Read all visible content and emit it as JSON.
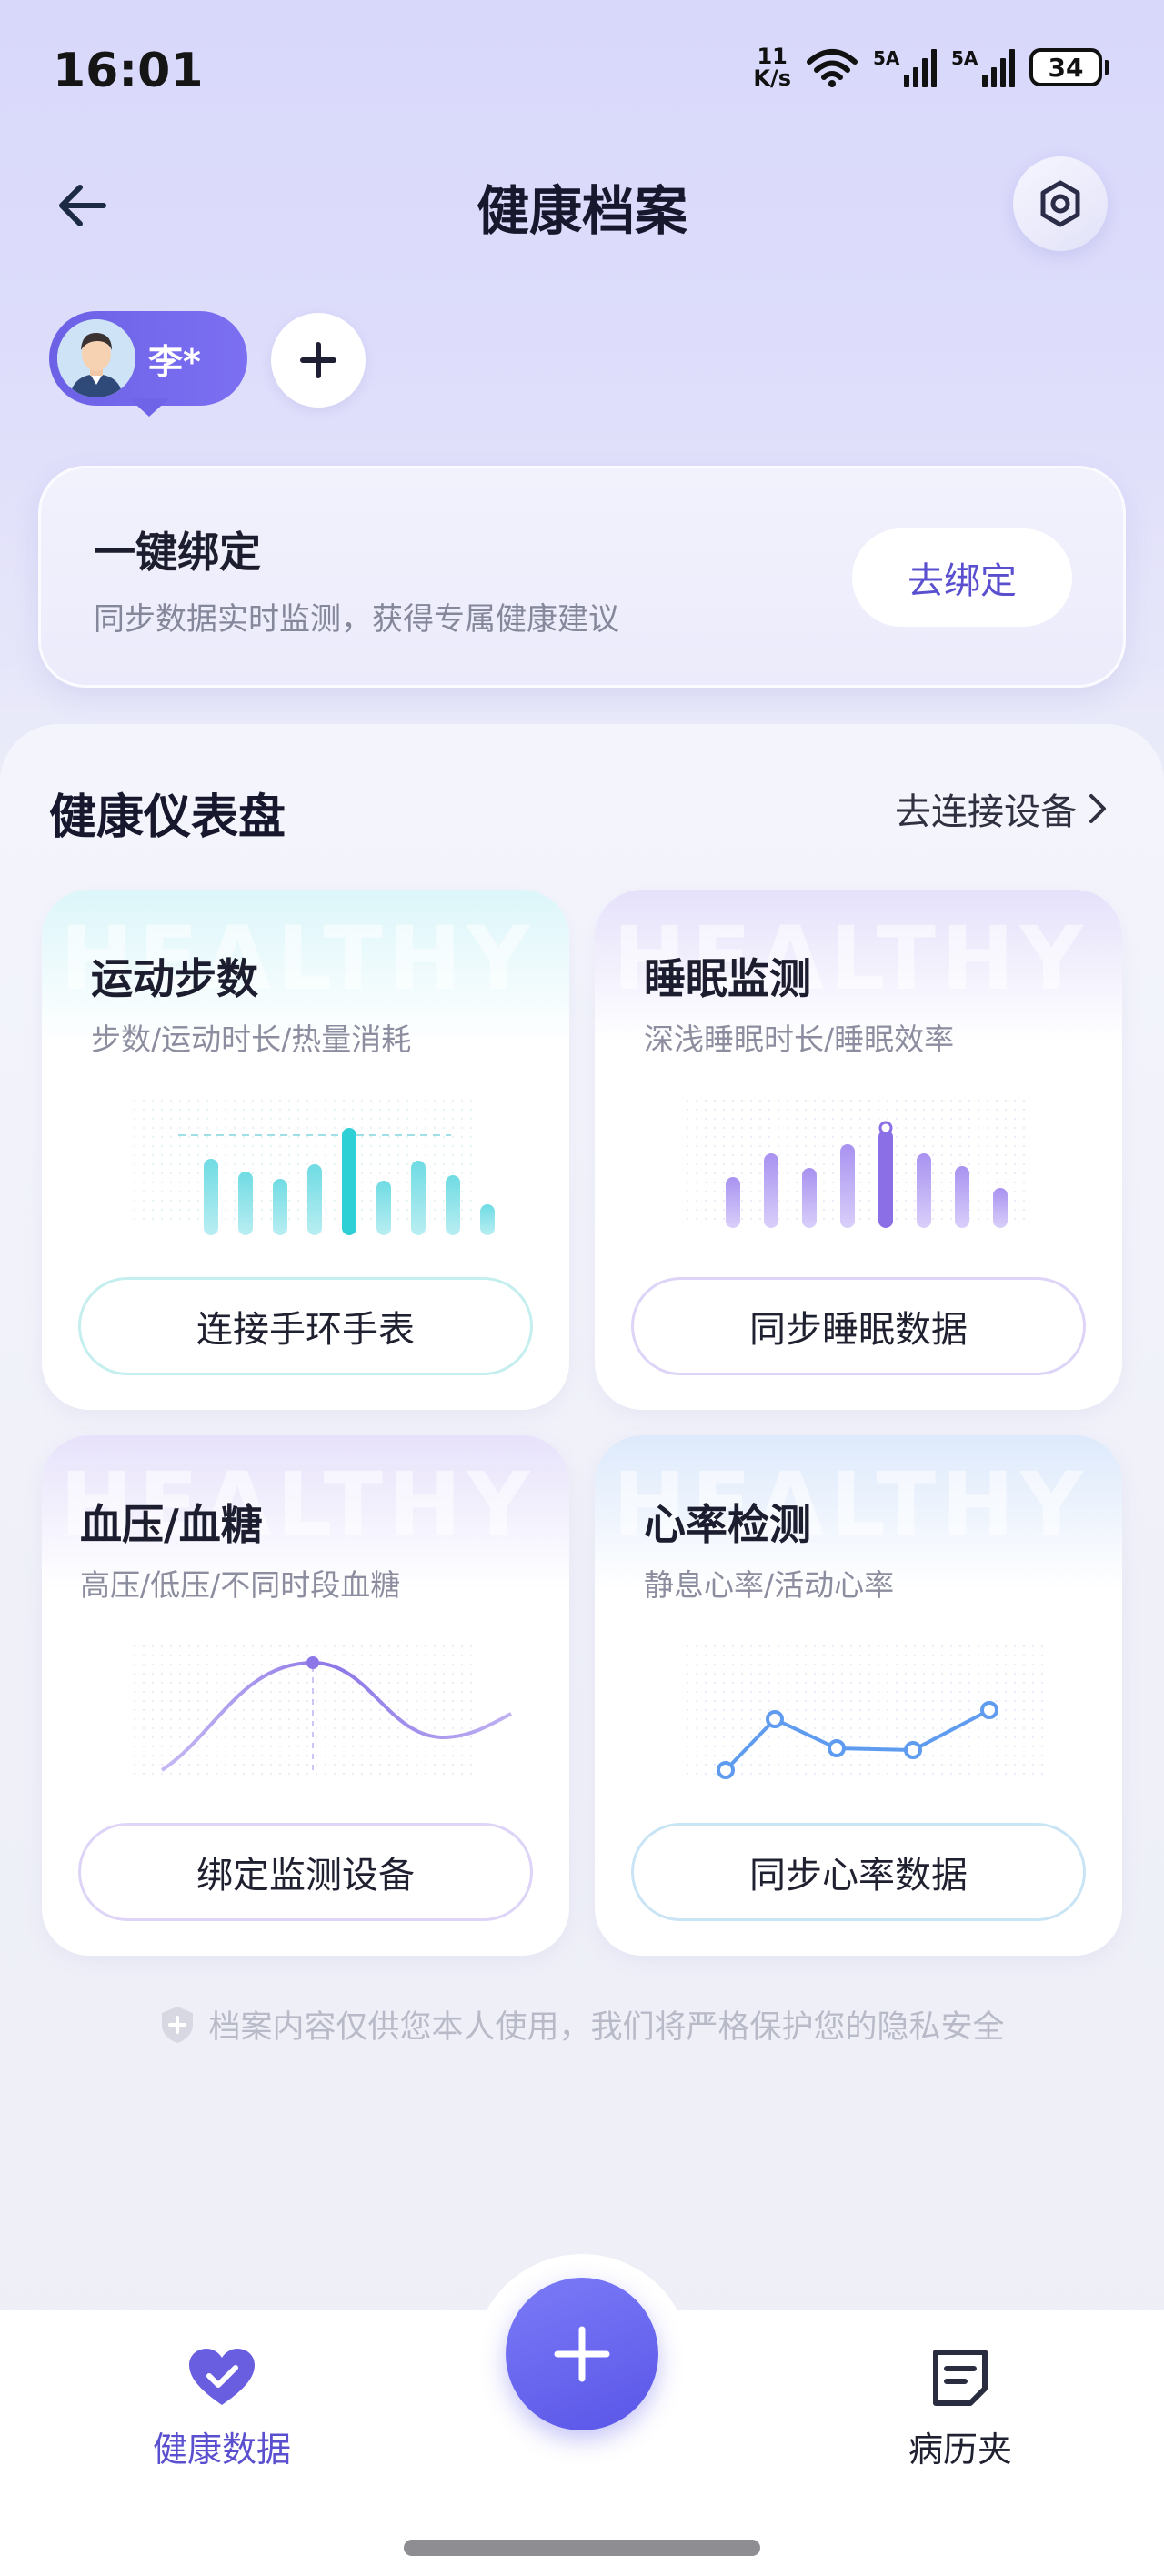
{
  "status_bar": {
    "time": "16:01",
    "net_speed_value": "11",
    "net_speed_unit": "K/s",
    "sim1": "5A",
    "sim2": "5A",
    "battery": "34"
  },
  "header": {
    "title": "健康档案"
  },
  "profiles": {
    "active_name": "李*"
  },
  "bind_card": {
    "title": "一键绑定",
    "subtitle": "同步数据实时监测，获得专属健康建议",
    "button": "去绑定"
  },
  "dashboard": {
    "title": "健康仪表盘",
    "connect_link": "去连接设备",
    "watermark": "HEALTHY",
    "cards": [
      {
        "title": "运动步数",
        "subtitle": "步数/运动时长/热量消耗",
        "button": "连接手环手表",
        "accent": "#45d3d9"
      },
      {
        "title": "睡眠监测",
        "subtitle": "深浅睡眠时长/睡眠效率",
        "button": "同步睡眠数据",
        "accent": "#9b83ee"
      },
      {
        "title": "血压/血糖",
        "subtitle": "高压/低压/不同时段血糖",
        "button": "绑定监测设备",
        "accent": "#8c76e8"
      },
      {
        "title": "心率检测",
        "subtitle": "静息心率/活动心率",
        "button": "同步心率数据",
        "accent": "#5f9cf0"
      }
    ]
  },
  "privacy_note": "档案内容仅供您本人使用，我们将严格保护您的隐私安全",
  "tab_bar": {
    "tabs": [
      {
        "label": "健康数据",
        "icon": "heart-check-icon",
        "active": true
      },
      {
        "label": "病历夹",
        "icon": "folder-doc-icon",
        "active": false
      }
    ],
    "fab_icon": "plus-icon"
  },
  "colors": {
    "brand": "#5a55e8",
    "active_tab": "#5a50cf",
    "background": "#edeef7"
  }
}
